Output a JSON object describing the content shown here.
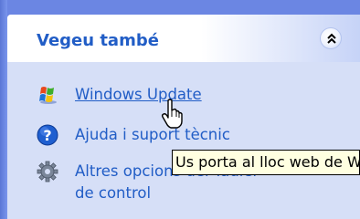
{
  "panel": {
    "title": "Vegeu també",
    "collapse_icon": "chevron-double-up-icon"
  },
  "tasks": [
    {
      "label": "Windows Update",
      "icon": "windows-flag-icon"
    },
    {
      "label": "Ajuda i suport tècnic",
      "icon": "help-question-icon"
    },
    {
      "label_line1": "Altres opcions del Tauler",
      "label_line2": "de control",
      "icon": "gear-icon"
    }
  ],
  "tooltip": {
    "text": "Us porta al lloc web de Windows Update"
  },
  "cursor": "hand-pointer-icon",
  "colors": {
    "link": "#215dc6",
    "panel_bg": "#d6dff7",
    "desktop_bg": "#6b86e3",
    "tooltip_bg": "#ffffe1"
  }
}
